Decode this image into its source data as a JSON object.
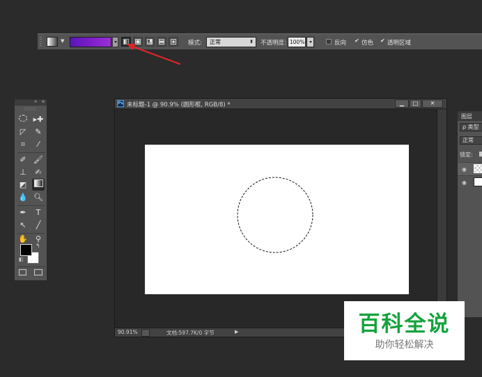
{
  "options_bar": {
    "mode_label": "模式:",
    "mode_value": "正常",
    "opacity_label": "不透明度:",
    "opacity_value": "100%",
    "reverse_label": "反向",
    "dither_label": "仿色",
    "transparency_label": "透明区域",
    "gradient_colors": [
      "#5a16b8",
      "#9b2fd4"
    ],
    "gradient_types": [
      "linear-gradient-icon",
      "radial-gradient-icon",
      "angle-gradient-icon",
      "reflected-gradient-icon",
      "diamond-gradient-icon"
    ]
  },
  "annotation": {
    "arrow_color": "#e0252a"
  },
  "tools": {
    "items": [
      "ellipse-marquee-icon",
      "move-icon",
      "polygonal-lasso-icon",
      "quick-selection-icon",
      "crop-icon",
      "eyedropper-icon",
      "healing-brush-icon",
      "brush-icon",
      "clone-stamp-icon",
      "history-brush-icon",
      "eraser-icon",
      "gradient-icon",
      "blur-icon",
      "dodge-icon",
      "pen-icon",
      "type-icon",
      "path-selection-icon",
      "line-icon",
      "hand-icon",
      "zoom-icon"
    ],
    "type_glyph": "T",
    "fg_color": "#000000",
    "bg_color": "#ffffff"
  },
  "document": {
    "ps_badge": "Ps",
    "title": "未标题-1 @ 90.9% (圆形框, RGB/8) *",
    "zoom": "90.91%",
    "doc_info": "文档:597.7K/0 字节"
  },
  "layers_panel": {
    "tab": "图层",
    "search": "ρ 类型",
    "blend": "正常",
    "lock": "锁定:"
  },
  "watermark": {
    "main": "百科全说",
    "sub": "助你轻松解决"
  }
}
